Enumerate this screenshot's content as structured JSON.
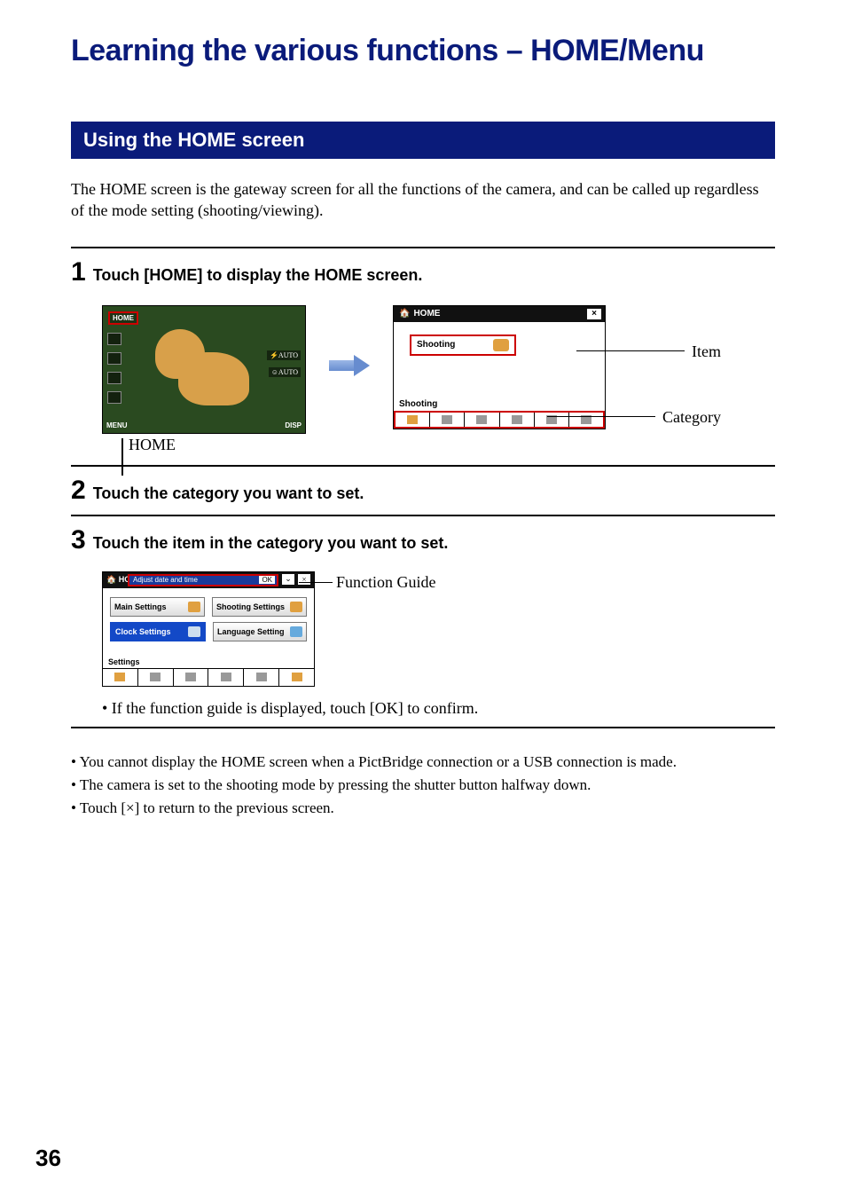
{
  "title": "Learning the various functions – HOME/Menu",
  "section": "Using the HOME screen",
  "intro": "The HOME screen is the gateway screen for all the functions of the camera, and can be called up regardless of the mode setting (shooting/viewing).",
  "step1": {
    "num": "1",
    "text": "Touch [HOME] to display the HOME screen."
  },
  "step2": {
    "num": "2",
    "text": "Touch the category you want to set."
  },
  "step3": {
    "num": "3",
    "text": "Touch the item in the category you want to set."
  },
  "screen_left": {
    "home_btn": "HOME",
    "menu": "MENU",
    "disp": "DISP",
    "flash_auto": "AUTO",
    "smile_auto": "AUTO"
  },
  "home_caption": "HOME",
  "screen_home": {
    "header": "HOME",
    "close": "×",
    "item_label": "Shooting",
    "category_label": "Shooting"
  },
  "callouts": {
    "item": "Item",
    "category": "Category",
    "function_guide": "Function Guide"
  },
  "screen_settings": {
    "header": "HOME",
    "guide_text": "Adjust date and time",
    "ok": "OK",
    "arrow": "⌄",
    "close": "×",
    "buttons": {
      "main": "Main Settings",
      "shooting": "Shooting Settings",
      "clock": "Clock Settings",
      "language": "Language Setting"
    },
    "category_label": "Settings"
  },
  "step3_note": "• If the function guide is displayed, touch [OK] to confirm.",
  "notes": [
    "• You cannot display the HOME screen when a PictBridge connection or a USB connection is made.",
    "• The camera is set to the shooting mode by pressing the shutter button halfway down.",
    "• Touch [×] to return to the previous screen."
  ],
  "pagenum": "36"
}
